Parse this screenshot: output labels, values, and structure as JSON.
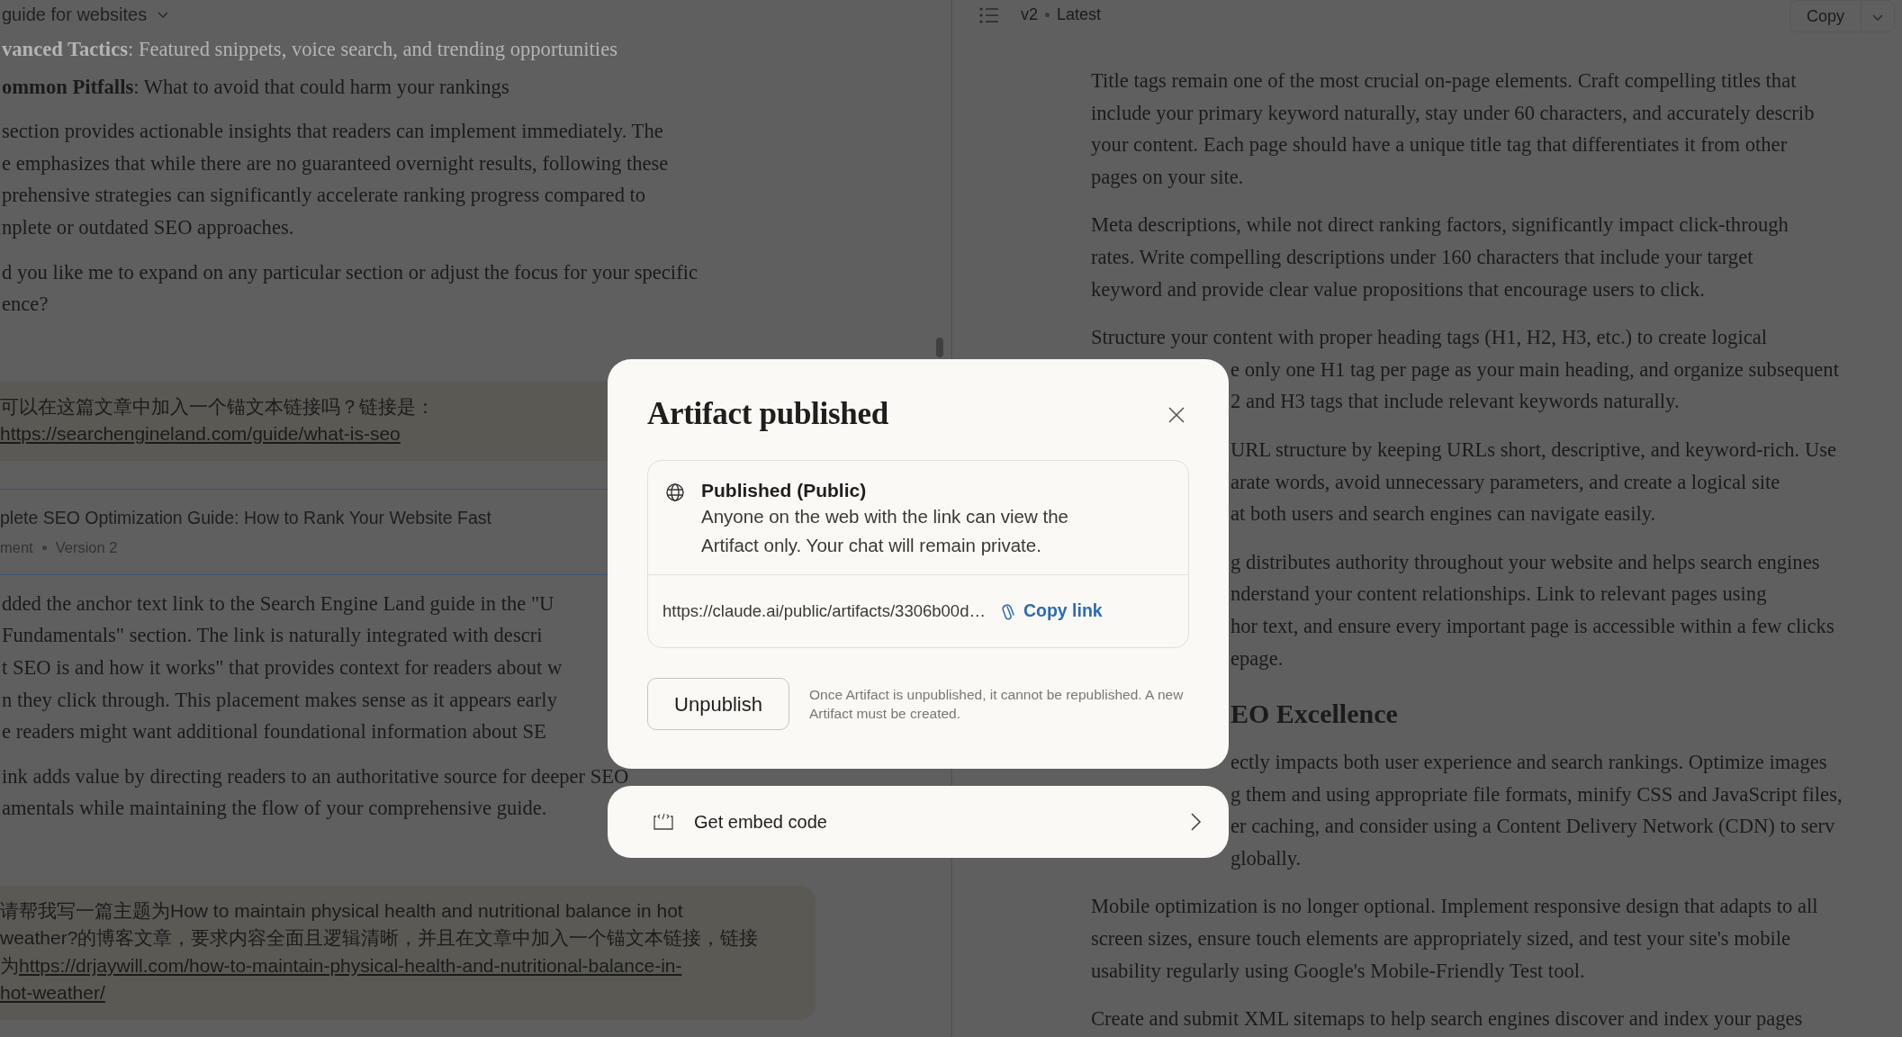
{
  "chat": {
    "title": "guide for websites",
    "blocks": [
      {
        "kind": "list_item",
        "faded": true,
        "text": "**vanced Tactics**: Featured snippets, voice search, and trending opportunities"
      },
      {
        "kind": "list_item",
        "faded": false,
        "text": "**ommon Pitfalls**: What to avoid that could harm your rankings"
      },
      {
        "kind": "paragraph",
        "lines": [
          "section provides actionable insights that readers can implement immediately. The",
          "e emphasizes that while there are no guaranteed overnight results, following these",
          "prehensive strategies can significantly accelerate ranking progress compared to",
          "nplete or outdated SEO approaches."
        ]
      },
      {
        "kind": "paragraph",
        "lines": [
          "d you like me to expand on any particular section or adjust the focus for your specific",
          "ence?"
        ]
      },
      {
        "kind": "user_message",
        "lines": [
          {
            "text": "可以在这篇文章中加入一个锚文本链接吗？链接是："
          },
          {
            "link": "https://searchengineland.com/guide/what-is-seo"
          }
        ]
      },
      {
        "kind": "artifact",
        "title": "plete SEO Optimization Guide: How to Rank Your Website Fast",
        "type": "ment",
        "version": "Version 2"
      },
      {
        "kind": "paragraph",
        "lines": [
          "dded the anchor text link to the Search Engine Land guide in the \"U",
          "Fundamentals\" section. The link is naturally integrated with descri",
          "t SEO is and how it works\" that provides context for readers about w",
          "n they click through. This placement makes sense as it appears early",
          "e readers might want additional foundational information about SE"
        ]
      },
      {
        "kind": "paragraph",
        "lines": [
          "ink adds value by directing readers to an authoritative source for deeper SEO",
          "amentals while maintaining the flow of your comprehensive guide."
        ]
      },
      {
        "kind": "user_message",
        "lines": [
          {
            "text": "请帮我写一篇主题为How to maintain physical health and nutritional balance in hot"
          },
          {
            "text": "weather?的博客文章，要求内容全面且逻辑清晰，并且在文章中加入一个锚文本链接，链接"
          },
          {
            "text": "为",
            "link": "https://drjaywill.com/how-to-maintain-physical-health-and-nutritional-balance-in-"
          },
          {
            "link": "hot-weather/"
          }
        ]
      }
    ]
  },
  "artifact_panel": {
    "version": "v2",
    "status": "Latest",
    "copy_button": "Copy",
    "blocks": [
      {
        "kind": "paragraph",
        "lines": [
          {
            "text": "Title tags remain one of the most crucial on-page elements. Craft compelling titles that",
            "covered": false
          },
          {
            "text": "include your primary keyword naturally, stay under 60 characters, and accurately describ",
            "covered": false
          },
          {
            "text": "your content. Each page should have a unique title tag that differentiates it from other",
            "covered": false
          },
          {
            "text": "pages on your site.",
            "covered": false
          }
        ]
      },
      {
        "kind": "paragraph",
        "lines": [
          {
            "text": "Meta descriptions, while not direct ranking factors, significantly impact click-through",
            "covered": false
          },
          {
            "text": "rates. Write compelling descriptions under 160 characters that include your target",
            "covered": false
          },
          {
            "text": "keyword and provide clear value propositions that encourage users to click.",
            "covered": false
          }
        ]
      },
      {
        "kind": "paragraph",
        "lines": [
          {
            "text": "Structure your content with proper heading tags (H1, H2, H3, etc.) to create logical",
            "covered": false
          },
          {
            "text": "e only one H1 tag per page as your main heading, and organize subsequent",
            "covered": true
          },
          {
            "text": "2 and H3 tags that include relevant keywords naturally.",
            "covered": true
          }
        ]
      },
      {
        "kind": "paragraph",
        "lines": [
          {
            "text": "URL structure by keeping URLs short, descriptive, and keyword-rich. Use",
            "covered": true
          },
          {
            "text": "arate words, avoid unnecessary parameters, and create a logical site",
            "covered": true
          },
          {
            "text": "at both users and search engines can navigate easily.",
            "covered": true
          }
        ]
      },
      {
        "kind": "paragraph",
        "lines": [
          {
            "text": "g distributes authority throughout your website and helps search engines",
            "covered": true
          },
          {
            "text": "nderstand your content relationships. Link to relevant pages using",
            "covered": true
          },
          {
            "text": "hor text, and ensure every important page is accessible within a few clicks",
            "covered": true
          },
          {
            "text": "epage.",
            "covered": true
          }
        ]
      },
      {
        "kind": "heading",
        "text": "EO Excellence",
        "covered": true
      },
      {
        "kind": "paragraph",
        "lines": [
          {
            "text": "ectly impacts both user experience and search rankings. Optimize images",
            "covered": true
          },
          {
            "text": "g them and using appropriate file formats, minify CSS and JavaScript files,",
            "covered": true
          },
          {
            "text": "er caching, and consider using a Content Delivery Network (CDN) to serv",
            "covered": true
          },
          {
            "text": "globally.",
            "covered": true
          }
        ]
      },
      {
        "kind": "paragraph",
        "lines": [
          {
            "text": "Mobile optimization is no longer optional. Implement responsive design that adapts to all",
            "covered": false
          },
          {
            "text": "screen sizes, ensure touch elements are appropriately sized, and test your site's mobile",
            "covered": false
          },
          {
            "text": "usability regularly using Google's Mobile-Friendly Test tool.",
            "covered": false
          }
        ]
      },
      {
        "kind": "paragraph",
        "lines": [
          {
            "text": "Create and submit XML sitemaps to help search engines discover and index your pages",
            "covered": false
          }
        ]
      }
    ]
  },
  "dialog": {
    "title": "Artifact published",
    "status_title": "Published (Public)",
    "status_text": "Anyone on the web with the link can view the Artifact only. Your chat will remain private.",
    "url": "https://claude.ai/public/artifacts/3306b00d…",
    "copy_link": "Copy link",
    "unpublish_button": "Unpublish",
    "note": "Once Artifact is unpublished, it cannot be republished. A new Artifact must be created.",
    "embed_option": "Get embed code"
  }
}
